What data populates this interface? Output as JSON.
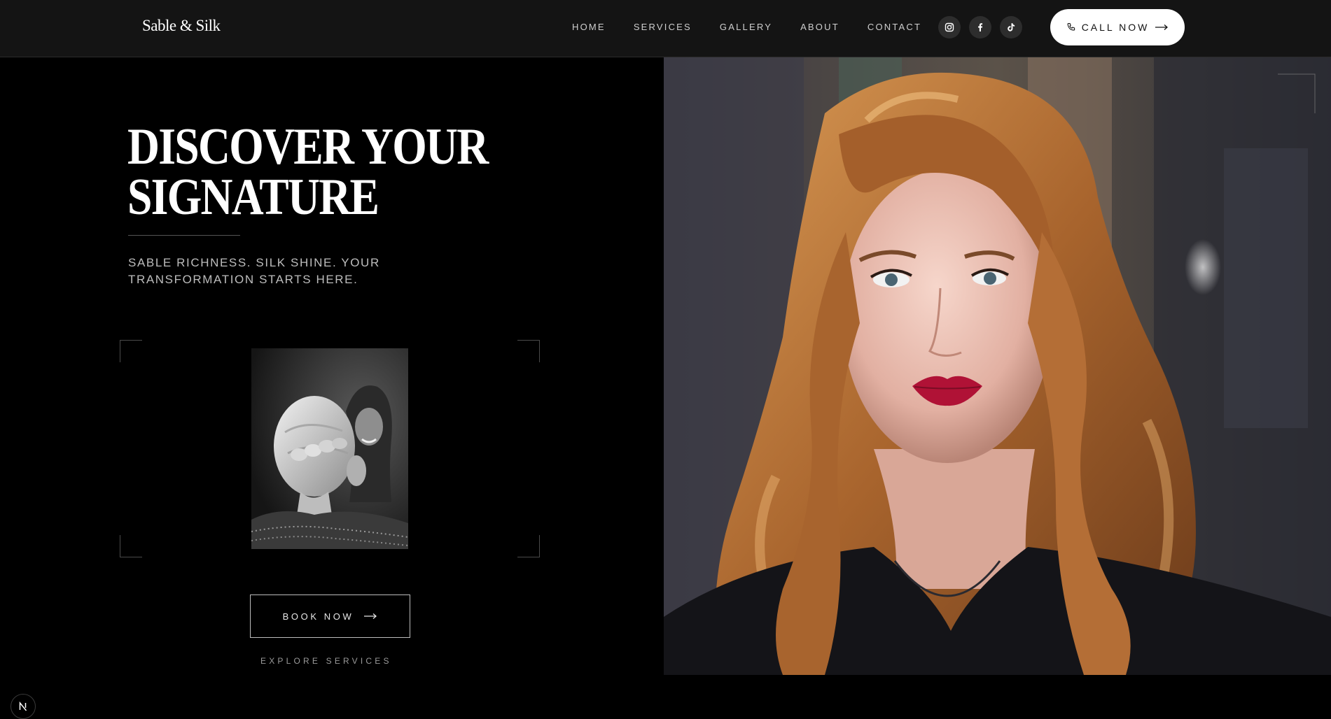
{
  "header": {
    "logo": "Sable & Silk",
    "nav": [
      {
        "label": "HOME"
      },
      {
        "label": "SERVICES"
      },
      {
        "label": "GALLERY"
      },
      {
        "label": "ABOUT"
      },
      {
        "label": "CONTACT"
      }
    ],
    "socials": [
      "instagram-icon",
      "facebook-icon",
      "tiktok-icon"
    ],
    "call_label": "CALL NOW"
  },
  "hero": {
    "headline_line1": "DISCOVER YOUR",
    "headline_line2": "SIGNATURE",
    "tagline_line1": "SABLE RICHNESS. SILK SHINE. YOUR",
    "tagline_line2": "TRANSFORMATION STARTS HERE.",
    "book_label": "BOOK NOW",
    "explore_label": "EXPLORE SERVICES"
  },
  "colors": {
    "header_bg": "#141414",
    "page_bg": "#000000",
    "accent_white": "#ffffff",
    "muted_text": "#bdbdbd",
    "lip_red": "#b01236",
    "hair_copper": "#b8743a"
  }
}
